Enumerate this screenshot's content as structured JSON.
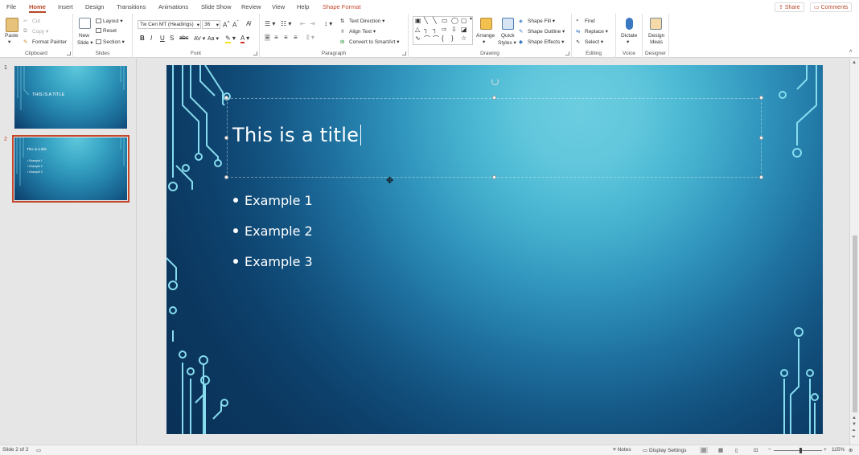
{
  "tabs": [
    "File",
    "Home",
    "Insert",
    "Design",
    "Transitions",
    "Animations",
    "Slide Show",
    "Review",
    "View",
    "Help",
    "Shape Format"
  ],
  "active_tab": "Home",
  "top_right": {
    "share": "Share",
    "comments": "Comments"
  },
  "ribbon": {
    "clipboard": {
      "paste": "Paste",
      "cut": "Cut",
      "copy": "Copy",
      "format_painter": "Format Painter",
      "label": "Clipboard"
    },
    "slides": {
      "new_slide": "New",
      "new_slide2": "Slide",
      "layout": "Layout",
      "reset": "Reset",
      "section": "Section",
      "label": "Slides"
    },
    "font": {
      "family": "Tw Cen MT (Headings)",
      "size": "36",
      "bold": "B",
      "italic": "I",
      "underline": "U",
      "strike": "S",
      "label": "Font"
    },
    "paragraph": {
      "text_direction": "Text Direction",
      "align_text": "Align Text",
      "convert_smartart": "Convert to SmartArt",
      "label": "Paragraph"
    },
    "drawing": {
      "arrange": "Arrange",
      "quick_styles": "Quick",
      "quick_styles2": "Styles",
      "shape_fill": "Shape Fill",
      "shape_outline": "Shape Outline",
      "shape_effects": "Shape Effects",
      "label": "Drawing"
    },
    "editing": {
      "find": "Find",
      "replace": "Replace",
      "select": "Select",
      "label": "Editing"
    },
    "voice": {
      "dictate": "Dictate",
      "label": "Voice"
    },
    "designer": {
      "design_ideas": "Design",
      "design_ideas2": "Ideas",
      "label": "Designer"
    }
  },
  "thumbnails": [
    {
      "number": "1",
      "title": "THIS IS A TITLE"
    },
    {
      "number": "2",
      "title": "This is a title",
      "bullets": [
        "Example 1",
        "Example 2",
        "Example 3"
      ]
    }
  ],
  "slide": {
    "title": "This is a title",
    "bullets": [
      "Example 1",
      "Example 2",
      "Example 3"
    ]
  },
  "status": {
    "slide_info": "Slide 2 of 2",
    "notes": "Notes",
    "display_settings": "Display Settings",
    "zoom": "115%",
    "zoom_level_fraction": 0.55
  },
  "colors": {
    "accent": "#b7472a",
    "selection": "#c4462b"
  }
}
